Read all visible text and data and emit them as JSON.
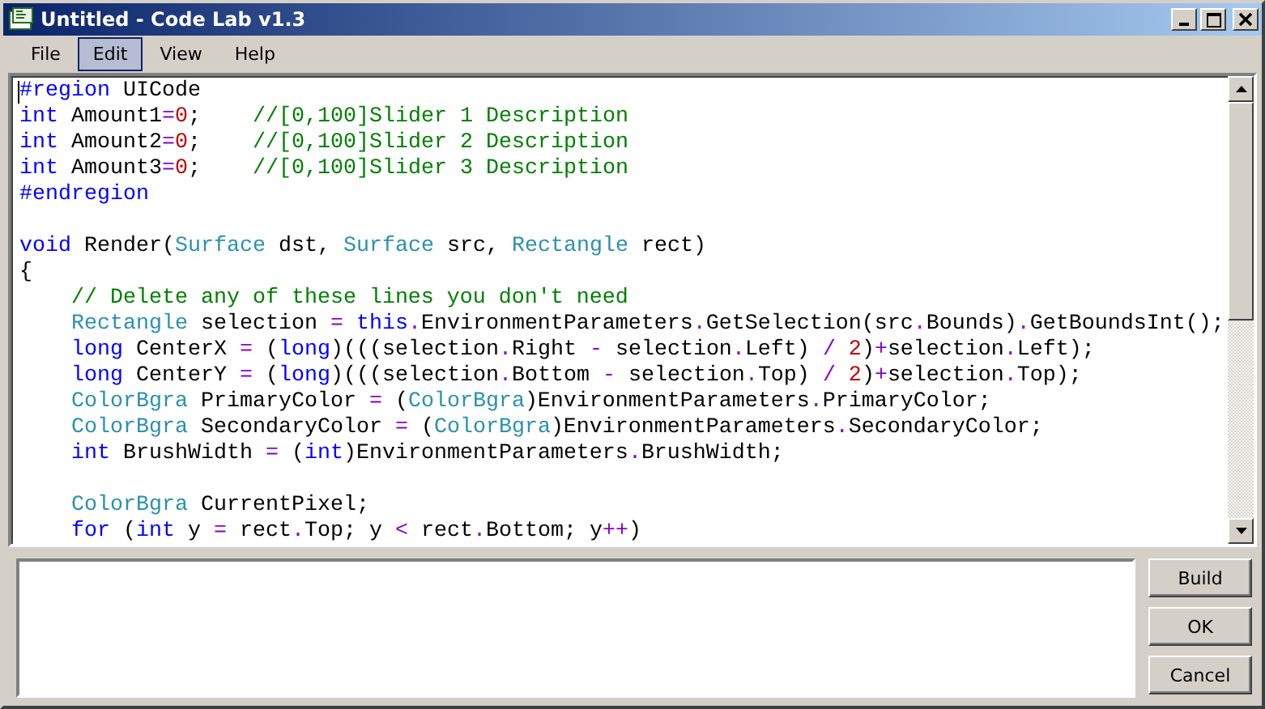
{
  "window": {
    "title": "Untitled - Code Lab v1.3"
  },
  "menu": [
    {
      "label": "File",
      "selected": false
    },
    {
      "label": "Edit",
      "selected": true
    },
    {
      "label": "View",
      "selected": false
    },
    {
      "label": "Help",
      "selected": false
    }
  ],
  "editor": {
    "lines": [
      {
        "tokens": [
          {
            "kind": "keyword",
            "text": "#region"
          },
          {
            "kind": "plain",
            "text": " UICode"
          }
        ]
      },
      {
        "tokens": [
          {
            "kind": "keyword",
            "text": "int"
          },
          {
            "kind": "plain",
            "text": " Amount1"
          },
          {
            "kind": "operator",
            "text": "="
          },
          {
            "kind": "number",
            "text": "0"
          },
          {
            "kind": "plain",
            "text": ";    "
          },
          {
            "kind": "comment",
            "text": "//[0,100]Slider 1 Description"
          }
        ]
      },
      {
        "tokens": [
          {
            "kind": "keyword",
            "text": "int"
          },
          {
            "kind": "plain",
            "text": " Amount2"
          },
          {
            "kind": "operator",
            "text": "="
          },
          {
            "kind": "number",
            "text": "0"
          },
          {
            "kind": "plain",
            "text": ";    "
          },
          {
            "kind": "comment",
            "text": "//[0,100]Slider 2 Description"
          }
        ]
      },
      {
        "tokens": [
          {
            "kind": "keyword",
            "text": "int"
          },
          {
            "kind": "plain",
            "text": " Amount3"
          },
          {
            "kind": "operator",
            "text": "="
          },
          {
            "kind": "number",
            "text": "0"
          },
          {
            "kind": "plain",
            "text": ";    "
          },
          {
            "kind": "comment",
            "text": "//[0,100]Slider 3 Description"
          }
        ]
      },
      {
        "blank_line_after": true,
        "tokens": [
          {
            "kind": "keyword",
            "text": "#endregion"
          }
        ]
      },
      {
        "tokens": [
          {
            "kind": "keyword",
            "text": "void"
          },
          {
            "kind": "plain",
            "text": " Render("
          },
          {
            "kind": "type",
            "text": "Surface"
          },
          {
            "kind": "plain",
            "text": " dst, "
          },
          {
            "kind": "type",
            "text": "Surface"
          },
          {
            "kind": "plain",
            "text": " src, "
          },
          {
            "kind": "type",
            "text": "Rectangle"
          },
          {
            "kind": "plain",
            "text": " rect)"
          }
        ]
      },
      {
        "tokens": [
          {
            "kind": "plain",
            "text": "{"
          }
        ]
      },
      {
        "indented": true,
        "tokens": [
          {
            "kind": "comment",
            "text": "// Delete any of these lines you don't need"
          }
        ]
      },
      {
        "indented": true,
        "tokens": [
          {
            "kind": "type",
            "text": "Rectangle"
          },
          {
            "kind": "plain",
            "text": " selection "
          },
          {
            "kind": "operator",
            "text": "="
          },
          {
            "kind": "keyword",
            "text": " this"
          },
          {
            "kind": "operator",
            "text": "."
          },
          {
            "kind": "plain",
            "text": "EnvironmentParameters"
          },
          {
            "kind": "operator",
            "text": "."
          },
          {
            "kind": "plain",
            "text": "GetSelection(src"
          },
          {
            "kind": "operator",
            "text": "."
          },
          {
            "kind": "plain",
            "text": "Bounds)"
          },
          {
            "kind": "operator",
            "text": "."
          },
          {
            "kind": "plain",
            "text": "GetBoundsInt();"
          }
        ]
      },
      {
        "indented": true,
        "tokens": [
          {
            "kind": "keyword",
            "text": "long"
          },
          {
            "kind": "plain",
            "text": " CenterX "
          },
          {
            "kind": "operator",
            "text": "="
          },
          {
            "kind": "plain",
            "text": " ("
          },
          {
            "kind": "keyword",
            "text": "long"
          },
          {
            "kind": "plain",
            "text": ")(((selection"
          },
          {
            "kind": "operator",
            "text": "."
          },
          {
            "kind": "plain",
            "text": "Right "
          },
          {
            "kind": "operator",
            "text": "-"
          },
          {
            "kind": "plain",
            "text": " selection"
          },
          {
            "kind": "operator",
            "text": "."
          },
          {
            "kind": "plain",
            "text": "Left) "
          },
          {
            "kind": "operator",
            "text": "/"
          },
          {
            "kind": "number",
            "text": " 2"
          },
          {
            "kind": "plain",
            "text": ")"
          },
          {
            "kind": "operator",
            "text": "+"
          },
          {
            "kind": "plain",
            "text": "selection"
          },
          {
            "kind": "operator",
            "text": "."
          },
          {
            "kind": "plain",
            "text": "Left);"
          }
        ]
      },
      {
        "indented": true,
        "tokens": [
          {
            "kind": "keyword",
            "text": "long"
          },
          {
            "kind": "plain",
            "text": " CenterY "
          },
          {
            "kind": "operator",
            "text": "="
          },
          {
            "kind": "plain",
            "text": " ("
          },
          {
            "kind": "keyword",
            "text": "long"
          },
          {
            "kind": "plain",
            "text": ")(((selection"
          },
          {
            "kind": "operator",
            "text": "."
          },
          {
            "kind": "plain",
            "text": "Bottom "
          },
          {
            "kind": "operator",
            "text": "-"
          },
          {
            "kind": "plain",
            "text": " selection"
          },
          {
            "kind": "operator",
            "text": "."
          },
          {
            "kind": "plain",
            "text": "Top) "
          },
          {
            "kind": "operator",
            "text": "/"
          },
          {
            "kind": "number",
            "text": " 2"
          },
          {
            "kind": "plain",
            "text": ")"
          },
          {
            "kind": "operator",
            "text": "+"
          },
          {
            "kind": "plain",
            "text": "selection"
          },
          {
            "kind": "operator",
            "text": "."
          },
          {
            "kind": "plain",
            "text": "Top);"
          }
        ]
      },
      {
        "indented": true,
        "tokens": [
          {
            "kind": "type",
            "text": "ColorBgra"
          },
          {
            "kind": "plain",
            "text": " PrimaryColor "
          },
          {
            "kind": "operator",
            "text": "="
          },
          {
            "kind": "plain",
            "text": " ("
          },
          {
            "kind": "type",
            "text": "ColorBgra"
          },
          {
            "kind": "plain",
            "text": ")EnvironmentParameters"
          },
          {
            "kind": "operator",
            "text": "."
          },
          {
            "kind": "plain",
            "text": "PrimaryColor;"
          }
        ]
      },
      {
        "indented": true,
        "tokens": [
          {
            "kind": "type",
            "text": "ColorBgra"
          },
          {
            "kind": "plain",
            "text": " SecondaryColor "
          },
          {
            "kind": "operator",
            "text": "="
          },
          {
            "kind": "plain",
            "text": " ("
          },
          {
            "kind": "type",
            "text": "ColorBgra"
          },
          {
            "kind": "plain",
            "text": ")EnvironmentParameters"
          },
          {
            "kind": "operator",
            "text": "."
          },
          {
            "kind": "plain",
            "text": "SecondaryColor;"
          }
        ]
      },
      {
        "indented": true,
        "blank_line_after": true,
        "tokens": [
          {
            "kind": "keyword",
            "text": "int"
          },
          {
            "kind": "plain",
            "text": " BrushWidth "
          },
          {
            "kind": "operator",
            "text": "="
          },
          {
            "kind": "plain",
            "text": " ("
          },
          {
            "kind": "keyword",
            "text": "int"
          },
          {
            "kind": "plain",
            "text": ")EnvironmentParameters"
          },
          {
            "kind": "operator",
            "text": "."
          },
          {
            "kind": "plain",
            "text": "BrushWidth;"
          }
        ]
      },
      {
        "indented": true,
        "tokens": [
          {
            "kind": "type",
            "text": "ColorBgra"
          },
          {
            "kind": "plain",
            "text": " CurrentPixel;"
          }
        ]
      },
      {
        "indented": true,
        "tokens": [
          {
            "kind": "keyword",
            "text": "for"
          },
          {
            "kind": "plain",
            "text": " ("
          },
          {
            "kind": "keyword",
            "text": "int"
          },
          {
            "kind": "plain",
            "text": " y "
          },
          {
            "kind": "operator",
            "text": "="
          },
          {
            "kind": "plain",
            "text": " rect"
          },
          {
            "kind": "operator",
            "text": "."
          },
          {
            "kind": "plain",
            "text": "Top; y "
          },
          {
            "kind": "operator",
            "text": "<"
          },
          {
            "kind": "plain",
            "text": " rect"
          },
          {
            "kind": "operator",
            "text": "."
          },
          {
            "kind": "plain",
            "text": "Bottom; y"
          },
          {
            "kind": "operator",
            "text": "++"
          },
          {
            "kind": "plain",
            "text": ")"
          }
        ]
      }
    ]
  },
  "buttons": [
    "Build",
    "OK",
    "Cancel"
  ]
}
